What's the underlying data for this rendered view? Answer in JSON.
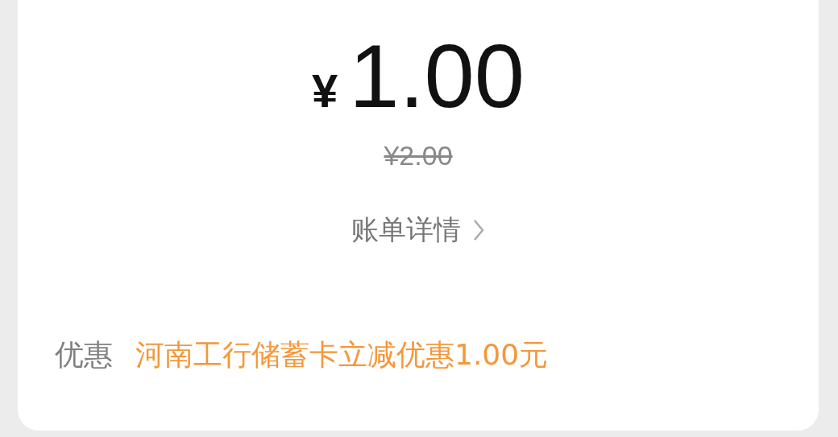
{
  "payment": {
    "currency": "¥",
    "amount": "1.00",
    "original_price": "¥2.00"
  },
  "bill_details_link": {
    "label": "账单详情"
  },
  "discount": {
    "label": "优惠",
    "text": "河南工行储蓄卡立减优惠1.00元"
  }
}
